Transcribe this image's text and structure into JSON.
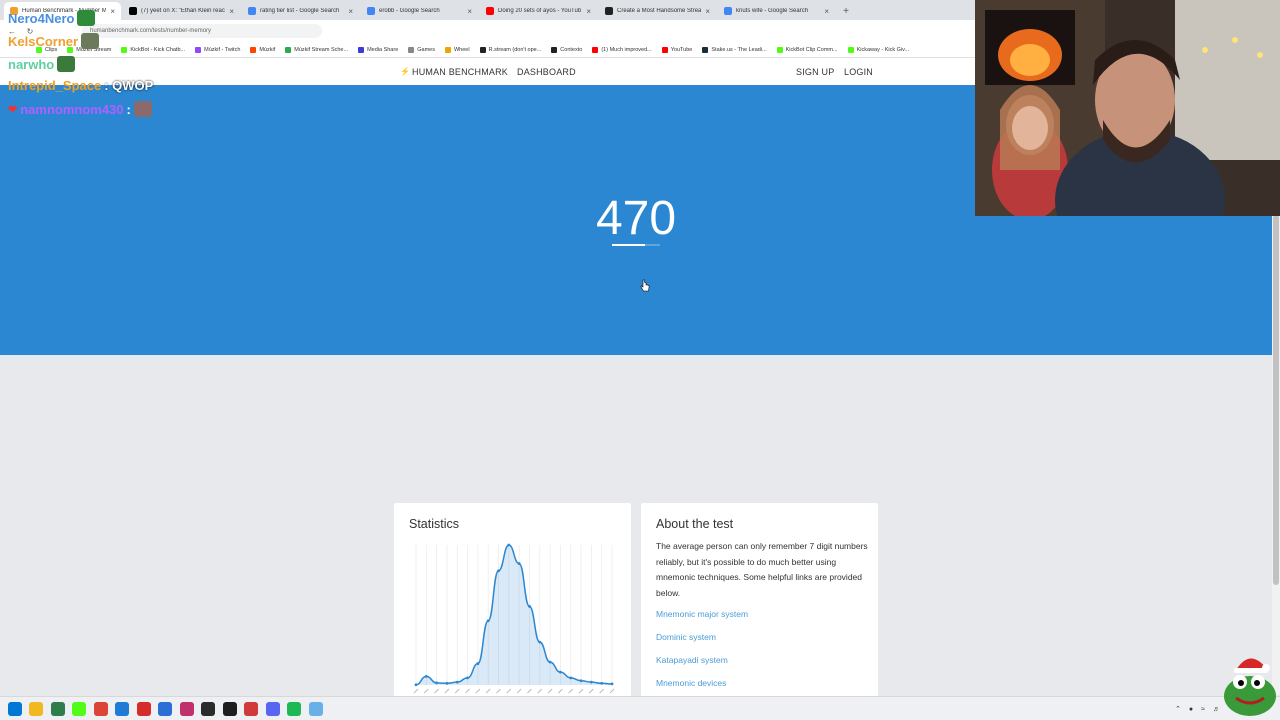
{
  "browser": {
    "tabs": [
      {
        "title": "Human Benchmark - Number M",
        "color": "#f0a030",
        "active": true
      },
      {
        "title": "(7) yeet on X: \"Ethan Klein reac",
        "color": "#000000",
        "active": false
      },
      {
        "title": "rating tier list - Google Search",
        "color": "#4285f4",
        "active": false
      },
      {
        "title": "erobb - Google Search",
        "color": "#4285f4",
        "active": false
      },
      {
        "title": "Doing 20 sets of ayos - YouTub",
        "color": "#ff0000",
        "active": false
      },
      {
        "title": "Create a Most Handsome Strea",
        "color": "#222222",
        "active": false
      },
      {
        "title": "knuts wife - Google Search",
        "color": "#4285f4",
        "active": false
      }
    ],
    "url": "humanbenchmark.com/tests/number-memory",
    "bookmarks": [
      {
        "label": "Clips",
        "color": "#53fc18"
      },
      {
        "label": "Múzkif Stream",
        "color": "#53fc18"
      },
      {
        "label": "KickBot - Kick Chatb...",
        "color": "#53fc18"
      },
      {
        "label": "Múzkif - Twitch",
        "color": "#9146ff"
      },
      {
        "label": "Múzkif",
        "color": "#ff4500"
      },
      {
        "label": "Múzkif Stream Sche...",
        "color": "#2fa84f"
      },
      {
        "label": "Media Share",
        "color": "#3b3bd6"
      },
      {
        "label": "Games",
        "color": "#888888"
      },
      {
        "label": "Wheel",
        "color": "#e8a800"
      },
      {
        "label": "R.stream (don't ope...",
        "color": "#222222"
      },
      {
        "label": "Contexto",
        "color": "#222222"
      },
      {
        "label": "(1) Much improved...",
        "color": "#ff0000"
      },
      {
        "label": "YouTube",
        "color": "#ff0000"
      },
      {
        "label": "Stake.us - The Leadi...",
        "color": "#1a2c38"
      },
      {
        "label": "KickBot Clip Comm...",
        "color": "#53fc18"
      },
      {
        "label": "Kickaway - Kick Giv...",
        "color": "#53fc18"
      }
    ]
  },
  "site_nav": {
    "brand": "HUMAN BENCHMARK",
    "dashboard": "DASHBOARD",
    "signup": "SIGN UP",
    "login": "LOGIN"
  },
  "test": {
    "number": "470",
    "timer_progress": 0.68,
    "bg_color": "#2b87d1"
  },
  "statistics": {
    "title": "Statistics",
    "chart_data": {
      "type": "area",
      "x": [
        1,
        2,
        3,
        4,
        5,
        6,
        7,
        8,
        9,
        10,
        11,
        12,
        13,
        14,
        15,
        16,
        17,
        18,
        19,
        20
      ],
      "values": [
        0.2,
        6,
        1.5,
        1.2,
        2,
        5,
        15,
        45,
        80,
        98,
        85,
        55,
        30,
        16,
        9,
        5,
        3,
        2,
        1.2,
        0.8
      ],
      "title": "",
      "xlabel": "",
      "ylabel": "",
      "grid": true
    }
  },
  "about": {
    "title": "About the test",
    "text": "The average person can only remember 7 digit numbers reliably, but it's possible to do much better using mnemonic techniques. Some helpful links are provided below.",
    "links": [
      "Mnemonic major system",
      "Dominic system",
      "Katapayadi system",
      "Mnemonic devices"
    ]
  },
  "chat": [
    {
      "user": "Nero4Nero",
      "message": "",
      "color": "#4a8fe0"
    },
    {
      "user": "KelsCorner",
      "message": "",
      "color": "#f0a030"
    },
    {
      "user": "narwho",
      "message": "",
      "color": "#5fd0a0"
    },
    {
      "user": "Intrepid_Space",
      "message": ": QWOP",
      "color": "#f0a020"
    },
    {
      "user": "namnomnom430",
      "message": ":",
      "color": "#b060ff"
    }
  ],
  "colors": {
    "accent": "#2b87d1",
    "link": "#4a9bd8",
    "page_bg": "#e8e9ed"
  },
  "taskbar": {
    "icons": [
      {
        "name": "windows-start-icon",
        "color": "#0078d4"
      },
      {
        "name": "file-explorer-icon",
        "color": "#f2b822"
      },
      {
        "name": "app-icon",
        "color": "#2f7d4a"
      },
      {
        "name": "kick-icon",
        "color": "#53fc18"
      },
      {
        "name": "chrome-icon",
        "color": "#db4437"
      },
      {
        "name": "edge-icon",
        "color": "#1f7bd6"
      },
      {
        "name": "app-red-icon",
        "color": "#d52b2b"
      },
      {
        "name": "app-blue-icon",
        "color": "#2a6fd6"
      },
      {
        "name": "app-pink-icon",
        "color": "#c0306a"
      },
      {
        "name": "obs-icon",
        "color": "#2b2b2b"
      },
      {
        "name": "app-dark-icon",
        "color": "#1e1e1e"
      },
      {
        "name": "app-chat-icon",
        "color": "#d13a3a"
      },
      {
        "name": "discord-icon",
        "color": "#5865f2"
      },
      {
        "name": "spotify-icon",
        "color": "#1db954"
      },
      {
        "name": "app-light-icon",
        "color": "#6ab0e8"
      }
    ]
  }
}
